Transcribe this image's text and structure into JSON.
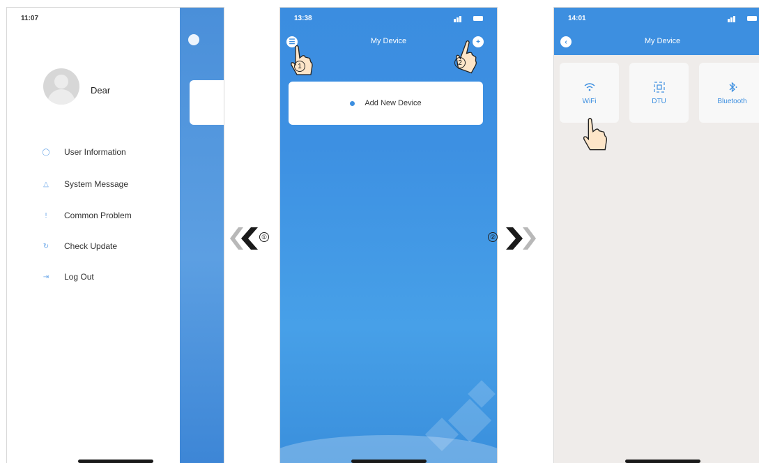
{
  "screen_left": {
    "status_time": "11:07",
    "user_name": "Dear",
    "menu_items": [
      {
        "label": "User Information",
        "icon": "user-icon"
      },
      {
        "label": "System Message",
        "icon": "bell-icon"
      },
      {
        "label": "Common Problem",
        "icon": "info-icon"
      },
      {
        "label": "Check Update",
        "icon": "update-icon"
      },
      {
        "label": "Log Out",
        "icon": "logout-icon"
      }
    ]
  },
  "screen_center": {
    "status_time": "13:38",
    "title": "My Device",
    "add_device_label": "Add New Device",
    "callouts": [
      "1",
      "2"
    ]
  },
  "screen_right": {
    "status_time": "14:01",
    "title": "My Device",
    "device_types": [
      {
        "label": "WiFi",
        "icon": "wifi-icon"
      },
      {
        "label": "DTU",
        "icon": "dtu-icon"
      },
      {
        "label": "Bluetooth",
        "icon": "bluetooth-icon"
      }
    ]
  },
  "step_markers": {
    "left": "①",
    "right": "②"
  },
  "colors": {
    "brand_blue": "#3d8fe0",
    "arrow_dark": "#1a1a1a",
    "arrow_light": "#b8b8b8"
  }
}
